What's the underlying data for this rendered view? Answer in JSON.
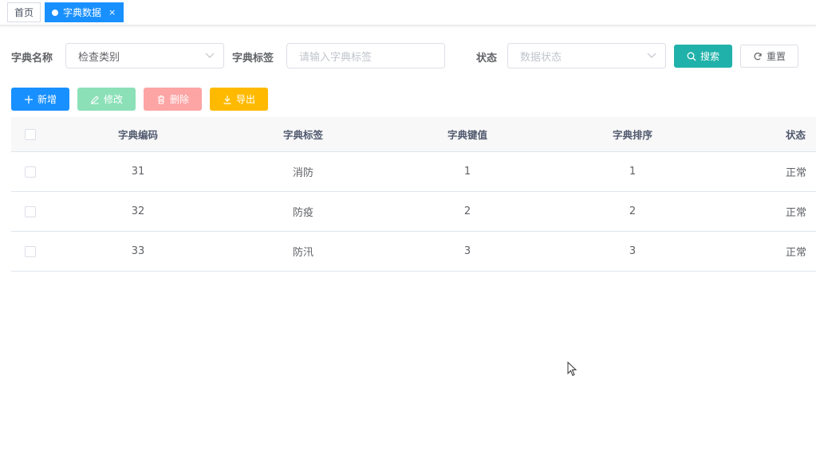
{
  "tags": {
    "home": "首页",
    "active": "字典数据",
    "close": "×"
  },
  "search": {
    "dict_name_label": "字典名称",
    "dict_name_value": "检查类别",
    "dict_label_label": "字典标签",
    "dict_label_placeholder": "请输入字典标签",
    "status_label": "状态",
    "status_placeholder": "数据状态",
    "search_button": "搜索",
    "reset_button": "重置"
  },
  "toolbar": {
    "add": "新增",
    "edit": "修改",
    "delete": "删除",
    "export": "导出"
  },
  "table": {
    "headers": [
      "字典编码",
      "字典标签",
      "字典键值",
      "字典排序",
      "状态"
    ],
    "rows": [
      [
        "31",
        "消防",
        "1",
        "1",
        "正常"
      ],
      [
        "32",
        "防疫",
        "2",
        "2",
        "正常"
      ],
      [
        "33",
        "防汛",
        "3",
        "3",
        "正常"
      ]
    ]
  },
  "colors": {
    "primary": "#1890ff",
    "search": "#20b2aa",
    "edit": "#8ce0b8",
    "delete": "#fda4a4",
    "export": "#ffba00"
  }
}
